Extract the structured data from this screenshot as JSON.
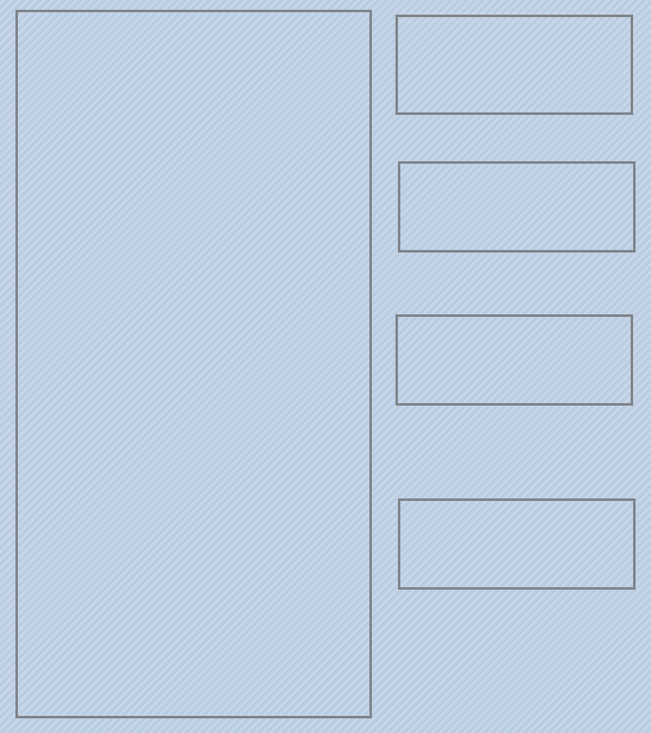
{
  "page": {
    "background_color": "#c2d3e6",
    "border_color": "#7e8388"
  },
  "main_panel": {
    "content": ""
  },
  "side_boxes": [
    {
      "content": ""
    },
    {
      "content": ""
    },
    {
      "content": ""
    },
    {
      "content": ""
    }
  ]
}
